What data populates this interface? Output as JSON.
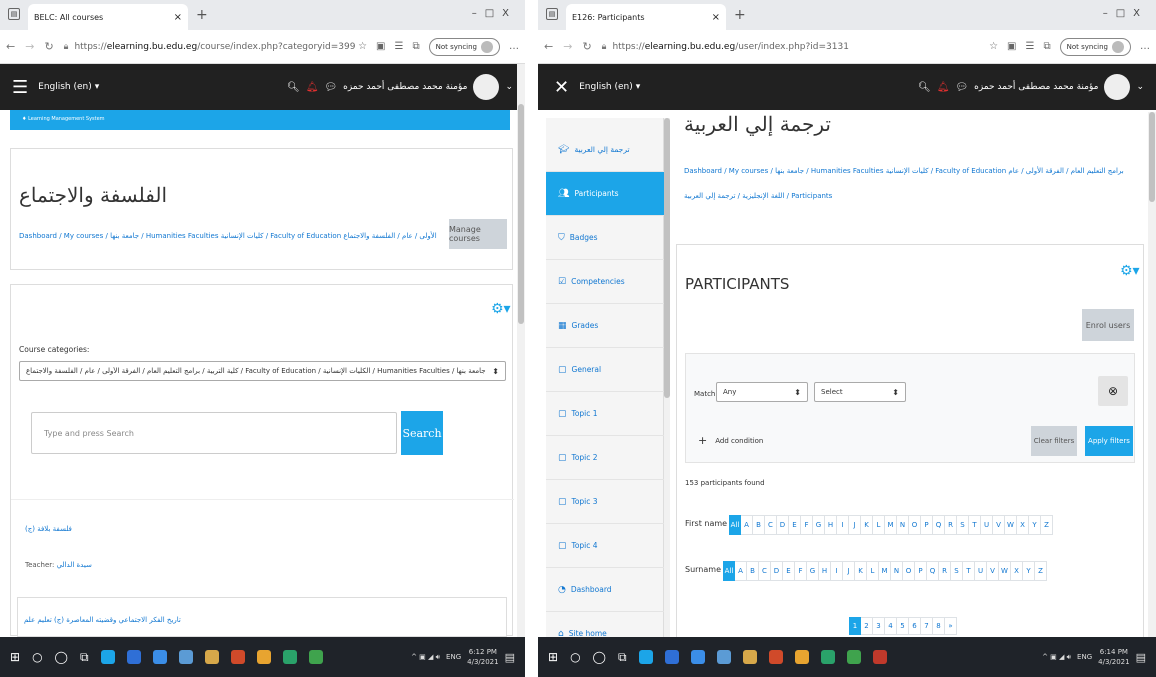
{
  "left": {
    "tab_title": "BELC: All courses",
    "url_prefix": "https://",
    "url_domain": "elearning.bu.edu.eg",
    "url_path": "/course/index.php?categoryid=399",
    "not_syncing": "Not syncing",
    "language": "English (en)",
    "username": "مؤمنة محمد مصطفى أحمد حمزه",
    "breadcrumb_small": "Learning Management System",
    "page_title": "الفلسفة والاجتماع",
    "breadcrumb": "Dashboard / My courses / جامعة بنها / Humanities Faculties كليات الإنسانية / Faculty of Education كلية التربية / برامج التعليم العام / الفرقة الأولى / عام / الفلسفة والاجتماع",
    "manage_courses": "Manage courses",
    "course_categories_label": "Course categories:",
    "category_select": "كلية التربية / برامج التعليم العام / الفرقة الأولى / عام / الفلسفة والاجتماع / Faculty of Education / الكليات الإنسانية / Humanities Faculties / جامعة بنها",
    "search_placeholder": "Type and press Search",
    "search_button": "Search",
    "course1_name": "فلسفة بلافة (ج)",
    "course1_teacher_label": "Teacher:",
    "course1_teacher": "سيدة الدالي",
    "course2_name": "تاريخ الفكر الاجتماعي وقضيته المعاصرة (ج) تعليم علم"
  },
  "right": {
    "tab_title": "E126: Participants",
    "url_prefix": "https://",
    "url_domain": "elearning.bu.edu.eg",
    "url_path": "/user/index.php?id=3131",
    "not_syncing": "Not syncing",
    "language": "English (en)",
    "username": "مؤمنة محمد مصطفى أحمد حمزه",
    "page_title": "ترجمة إلي العربية",
    "breadcrumb_line1": "Dashboard / My courses / جامعة بنها / Humanities Faculties كليات الإنسانية / Faculty of Education كلية التربية / برامج التعليم العام / الفرقة الأولى / عام",
    "breadcrumb_line2": "اللغة الإنجليزية / ترجمة إلي العربية / Participants",
    "sidebar": [
      {
        "label": "ترجمة إلي العربية",
        "icon": "graduation-cap-icon"
      },
      {
        "label": "Participants",
        "icon": "users-icon"
      },
      {
        "label": "Badges",
        "icon": "shield-icon"
      },
      {
        "label": "Competencies",
        "icon": "check-square-icon"
      },
      {
        "label": "Grades",
        "icon": "table-icon"
      },
      {
        "label": "General",
        "icon": "folder-icon"
      },
      {
        "label": "Topic 1",
        "icon": "folder-icon"
      },
      {
        "label": "Topic 2",
        "icon": "folder-icon"
      },
      {
        "label": "Topic 3",
        "icon": "folder-icon"
      },
      {
        "label": "Topic 4",
        "icon": "folder-icon"
      },
      {
        "label": "Dashboard",
        "icon": "tachometer-icon"
      },
      {
        "label": "Site home",
        "icon": "home-icon"
      }
    ],
    "participants_heading": "PARTICIPANTS",
    "enrol_users": "Enrol users",
    "match_label": "Match",
    "match_value": "Any",
    "select_value": "Select",
    "add_condition": "Add condition",
    "clear_filters": "Clear filters",
    "apply_filters": "Apply filters",
    "found_text": "153 participants found",
    "first_name_label": "First name",
    "surname_label": "Surname",
    "letters": [
      "All",
      "A",
      "B",
      "C",
      "D",
      "E",
      "F",
      "G",
      "H",
      "I",
      "J",
      "K",
      "L",
      "M",
      "N",
      "O",
      "P",
      "Q",
      "R",
      "S",
      "T",
      "U",
      "V",
      "W",
      "X",
      "Y",
      "Z"
    ],
    "pages": [
      "1",
      "2",
      "3",
      "4",
      "5",
      "6",
      "7",
      "8",
      "»"
    ]
  },
  "taskbar": {
    "left_time": "6:12 PM",
    "left_date": "4/3/2021",
    "right_time": "6:14 PM",
    "right_date": "4/3/2021",
    "lang": "ENG"
  },
  "colors": {
    "accent": "#1ca5e8",
    "navbar": "#212121",
    "taskbar": "#1f2329",
    "link": "#1177d1"
  }
}
